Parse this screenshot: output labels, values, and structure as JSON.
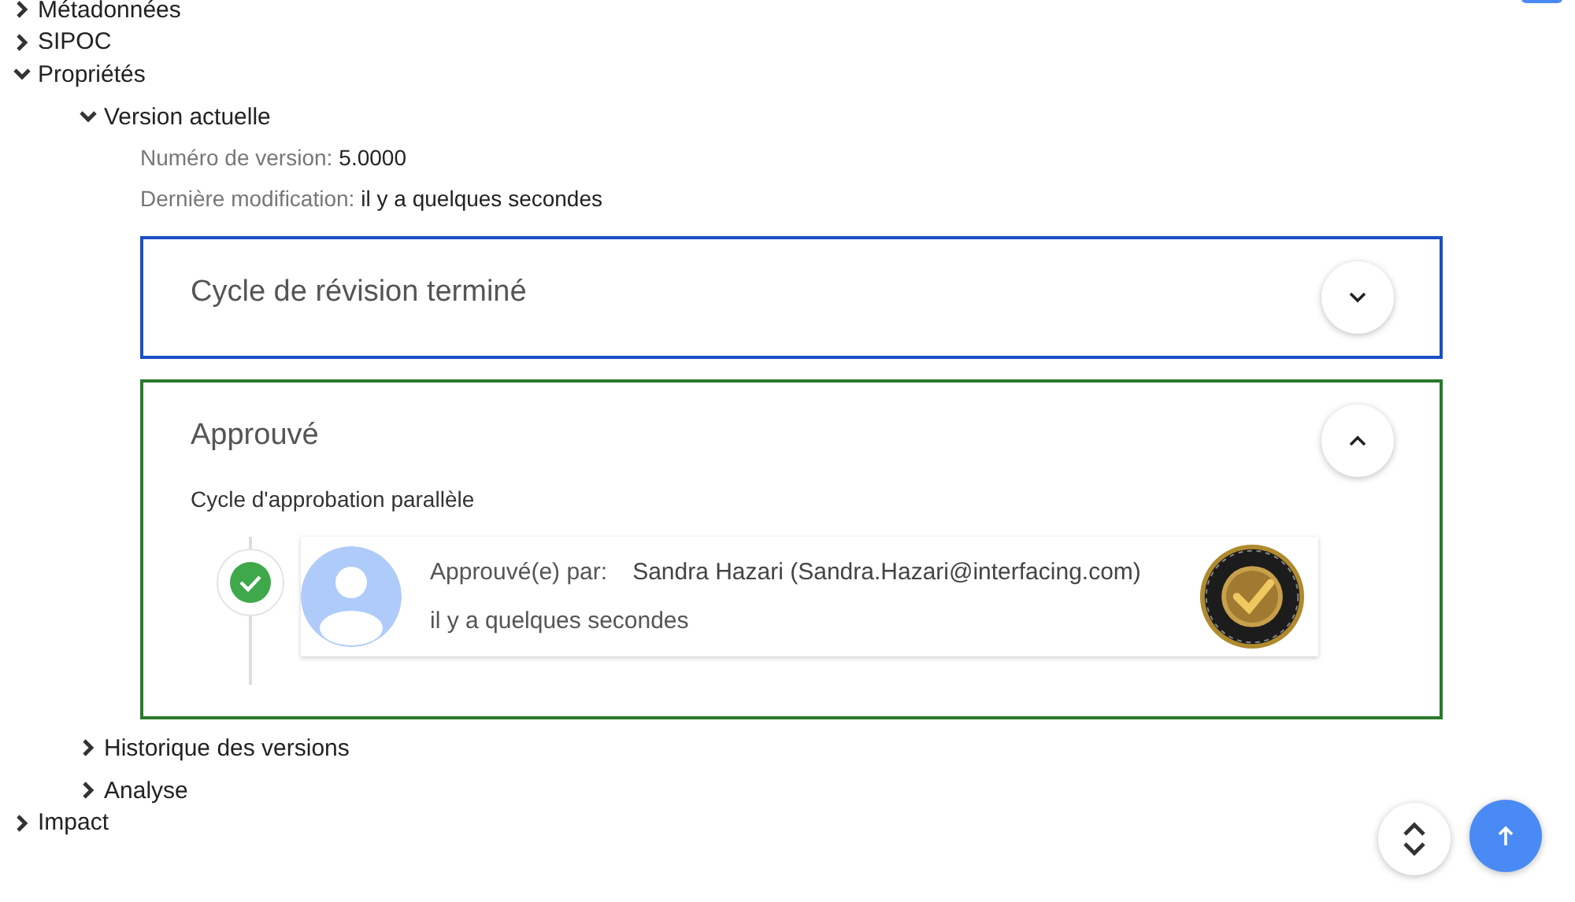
{
  "tree": [
    {
      "label": "Métadonnées",
      "expanded": false
    },
    {
      "label": "SIPOC",
      "expanded": false
    },
    {
      "label": "Propriétés",
      "expanded": true,
      "children": [
        {
          "label": "Version actuelle",
          "expanded": true,
          "details": [
            {
              "label": "Numéro de version:",
              "value": "5.0000"
            },
            {
              "label": "Dernière modification:",
              "value": "il y a quelques secondes"
            }
          ],
          "panels": [
            {
              "title": "Cycle de révision terminé",
              "expanded": false,
              "color": "#1a4fc4"
            },
            {
              "title": "Approuvé",
              "expanded": true,
              "color": "#2a7a2a",
              "subtitle": "Cycle d'approbation parallèle",
              "approvals": [
                {
                  "label": "Approuvé(e) par:",
                  "approver": "Sandra Hazari (Sandra.Hazari@interfacing.com)",
                  "time": "il y a quelques secondes",
                  "approved": true
                }
              ]
            }
          ]
        },
        {
          "label": "Historique des versions",
          "expanded": false
        },
        {
          "label": "Analyse",
          "expanded": false
        }
      ]
    },
    {
      "label": "Impact",
      "expanded": false
    }
  ]
}
